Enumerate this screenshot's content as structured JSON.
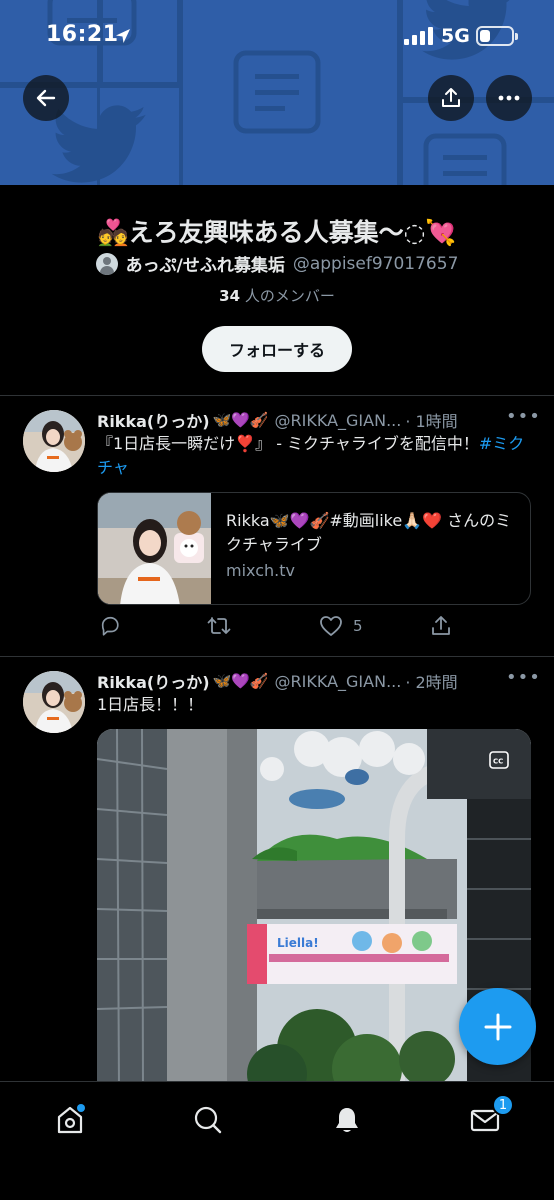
{
  "status_bar": {
    "time": "16:21",
    "network": "5G"
  },
  "community": {
    "title": "💑えろ友興味ある人募集〜◌💘",
    "owner_name": "あっぷ/せふれ募集垢",
    "owner_handle": "@appisef97017657",
    "member_count": "34",
    "member_label": " 人のメンバー",
    "follow_label": "フォローする"
  },
  "tweets": [
    {
      "name": "Rikka(りっか)",
      "emojis": "🦋💜🎻",
      "handle": "@RIKKA_GIAN...",
      "time": "· 1時間",
      "text": "『1日店長一瞬だけ❣️』 - ミクチャライブを配信中！",
      "hashtag": "#ミクチャ",
      "card": {
        "title": "Rikka🦋💜🎻#動画like🙏🏻❤️ さんのミクチャライブ",
        "domain": "mixch.tv"
      },
      "like_count": "5"
    },
    {
      "name": "Rikka(りっか)",
      "emojis": "🦋💜🎻",
      "handle": "@RIKKA_GIAN...",
      "time": "· 2時間",
      "text": "1日店長！！！",
      "media_sign": "Liella!"
    }
  ],
  "nav": {
    "messages_badge": "1"
  },
  "colors": {
    "accent": "#1d9bf0",
    "banner": "#2f5ea8",
    "background": "#000000"
  },
  "icons": {
    "back": "arrow-left-icon",
    "share": "share-icon",
    "more": "more-icon",
    "reply": "reply-icon",
    "retweet": "retweet-icon",
    "like": "heart-icon",
    "compose": "plus-icon",
    "home": "home-icon",
    "search": "search-icon",
    "notifications": "bell-icon",
    "messages": "envelope-icon"
  }
}
